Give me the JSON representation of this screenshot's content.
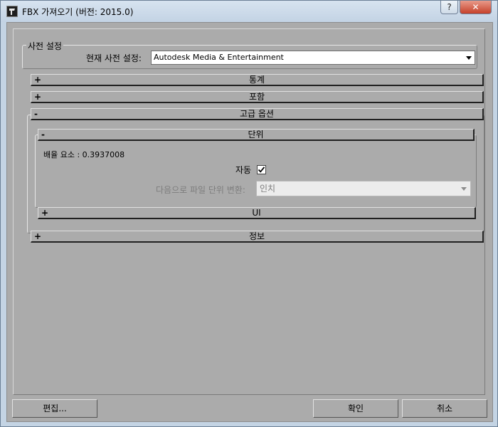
{
  "window": {
    "title": "FBX 가져오기 (버전: 2015.0)",
    "help_label": "?",
    "close_label": "✕"
  },
  "preset": {
    "group_label": "사전 설정",
    "current_label": "현재 사전 설정:",
    "current_value": "Autodesk Media & Entertainment"
  },
  "rollouts": {
    "statistics": {
      "sign": "+",
      "title": "통계"
    },
    "include": {
      "sign": "+",
      "title": "포함"
    },
    "advanced": {
      "sign": "-",
      "title": "고급 옵션"
    },
    "units": {
      "sign": "-",
      "title": "단위"
    },
    "ui": {
      "sign": "+",
      "title": "UI"
    },
    "info": {
      "sign": "+",
      "title": "정보"
    }
  },
  "units": {
    "scale_factor_label": "배율 요소 : 0.3937008",
    "auto_label": "자동",
    "auto_checked": true,
    "convert_label": "다음으로 파일 단위 변환:",
    "convert_value": "인치"
  },
  "buttons": {
    "edit": "편집...",
    "ok": "확인",
    "cancel": "취소"
  }
}
